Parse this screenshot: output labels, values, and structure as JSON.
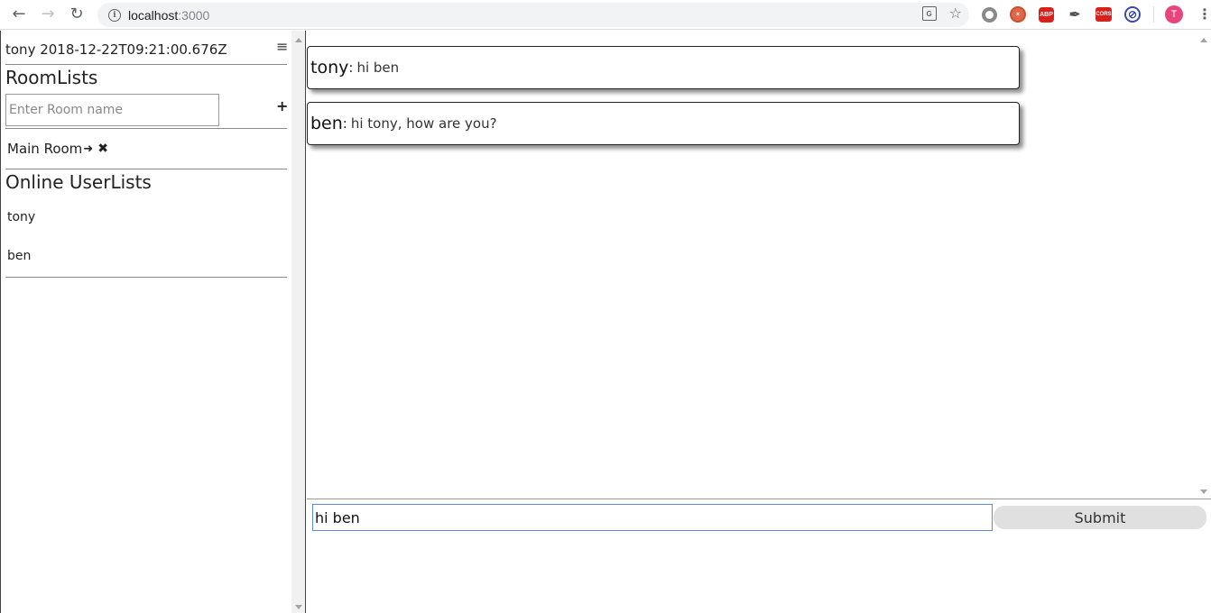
{
  "browser": {
    "url_host": "localhost",
    "url_port": ":3000",
    "info_icon": "info-icon",
    "profile_initial": "T",
    "extensions": [
      "ring-extension-icon",
      "orange-extension-icon",
      "ABP",
      "eyedropper-icon",
      "CORS",
      "block-extension-icon"
    ]
  },
  "sidebar": {
    "user_line": "tony 2018-12-22T09:21:00.676Z",
    "room_lists_title": "RoomLists",
    "room_input_placeholder": "Enter Room name",
    "add_room_icon": "+",
    "rooms": [
      {
        "name": "Main Room"
      }
    ],
    "online_users_title": "Online UserLists",
    "users": [
      "tony",
      "ben"
    ]
  },
  "chat": {
    "messages": [
      {
        "user": "tony",
        "text": "hi ben"
      },
      {
        "user": "ben",
        "text": "hi tony, how are you?"
      }
    ],
    "input_value": "hi ben",
    "submit_label": "Submit"
  },
  "colors": {
    "input_focus_border": "#5b8bd9",
    "submit_bg": "#e0e0e0",
    "profile_bg": "#e8457e"
  }
}
